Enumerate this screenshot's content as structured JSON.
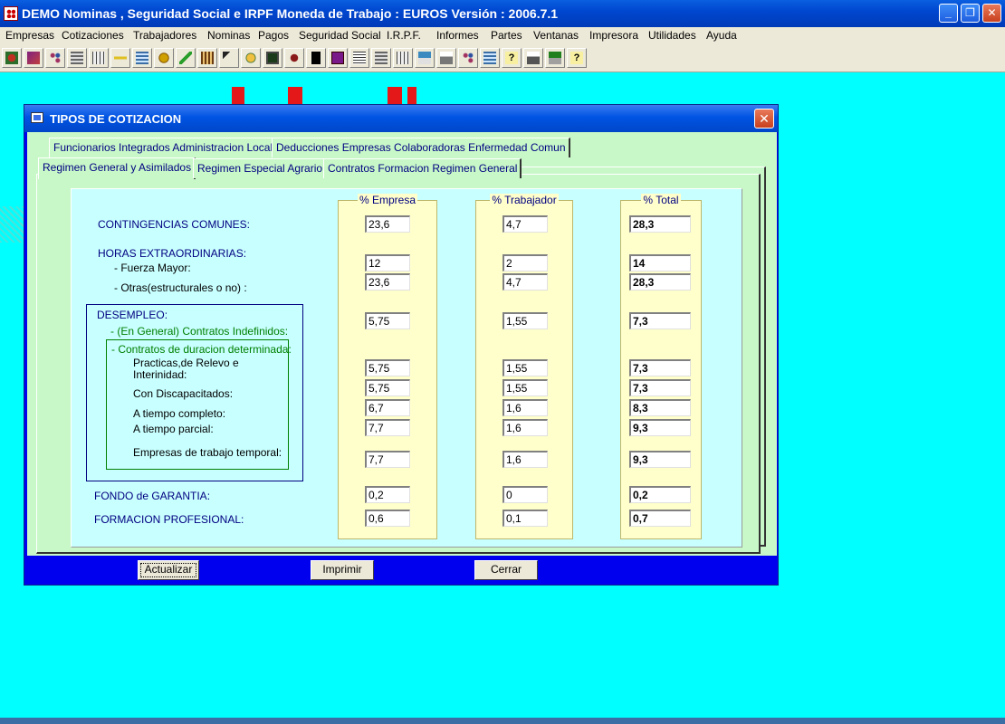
{
  "app": {
    "title": "DEMO Nominas , Seguridad Social e IRPF  Moneda de Trabajo : EUROS  Versión :  2006.7.1",
    "window_buttons": {
      "minimize": "_",
      "maximize": "❐",
      "close": "✕"
    }
  },
  "menu": [
    "Empresas",
    "Cotizaciones",
    "Trabajadores",
    "Nominas",
    "Pagos",
    "Seguridad Social",
    "I.R.P.F.",
    "Informes",
    "Partes",
    "Ventanas",
    "Impresora",
    "Utilidades",
    "Ayuda"
  ],
  "toolbar_icons": [
    "company-icon",
    "chart-icon",
    "network-icon",
    "calculator-icon",
    "grid-icon",
    "cross-icon",
    "list-icon",
    "gear-icon",
    "pencil-icon",
    "building-icon",
    "cursor-icon",
    "hand-icon",
    "screen-icon",
    "tools-icon",
    "black-box-icon",
    "purple-book-icon",
    "document-icon",
    "calculator2-icon",
    "grid2-icon",
    "stamp-icon",
    "printer-icon",
    "network2-icon",
    "list2-icon",
    "help-icon",
    "printer2-icon",
    "fax-icon",
    "help2-icon"
  ],
  "dialog": {
    "title": "TIPOS DE COTIZACION",
    "close": "✕",
    "tabs_row1": [
      "Funcionarios Integrados Administracion Local",
      "Deducciones Empresas Colaboradoras Enfermedad Comun"
    ],
    "tabs_row2": [
      "Regimen General y Asimilados",
      "Regimen Especial Agrario",
      "Contratos Formacion Regimen General"
    ],
    "columns": [
      "% Empresa",
      "% Trabajador",
      "% Total"
    ],
    "labels": {
      "contingencias": "CONTINGENCIAS COMUNES:",
      "horas": "HORAS EXTRAORDINARIAS:",
      "fuerza": "- Fuerza Mayor:",
      "otras": "- Otras(estructurales o no) :",
      "desempleo": "DESEMPLEO:",
      "indefinidos": "- (En General) Contratos Indefinidos:",
      "duracion": "- Contratos de duracion determinada:",
      "practicas1": "Practicas,de Relevo e",
      "practicas2": "Interinidad:",
      "discapacitados": "Con Discapacitados:",
      "completo": "A tiempo completo:",
      "parcial": "A tiempo parcial:",
      "ett": "Empresas de trabajo temporal:",
      "fondo": "FONDO de GARANTIA:",
      "formacion": "FORMACION PROFESIONAL:"
    },
    "rows": [
      {
        "empresa": "23,6",
        "trabajador": "4,7",
        "total": "28,3"
      },
      {
        "empresa": "12",
        "trabajador": "2",
        "total": "14"
      },
      {
        "empresa": "23,6",
        "trabajador": "4,7",
        "total": "28,3"
      },
      {
        "empresa": "5,75",
        "trabajador": "1,55",
        "total": "7,3"
      },
      {
        "empresa": "5,75",
        "trabajador": "1,55",
        "total": "7,3"
      },
      {
        "empresa": "5,75",
        "trabajador": "1,55",
        "total": "7,3"
      },
      {
        "empresa": "6,7",
        "trabajador": "1,6",
        "total": "8,3"
      },
      {
        "empresa": "7,7",
        "trabajador": "1,6",
        "total": "9,3"
      },
      {
        "empresa": "7,7",
        "trabajador": "1,6",
        "total": "9,3"
      },
      {
        "empresa": "0,2",
        "trabajador": "0",
        "total": "0,2"
      },
      {
        "empresa": "0,6",
        "trabajador": "0,1",
        "total": "0,7"
      }
    ],
    "buttons": {
      "actualizar": "Actualizar",
      "imprimir": "Imprimir",
      "cerrar": "Cerrar"
    }
  }
}
